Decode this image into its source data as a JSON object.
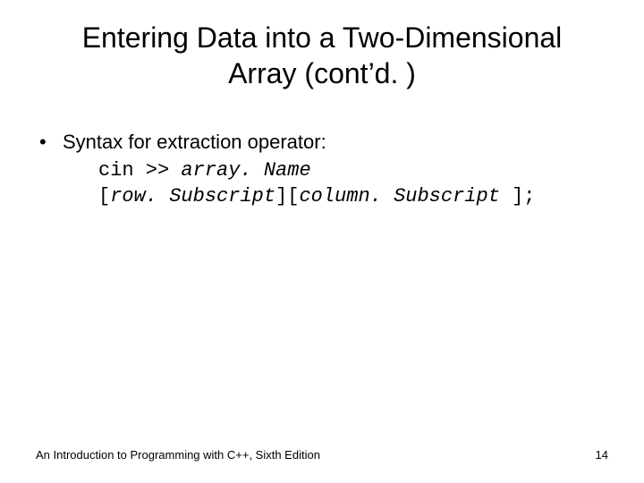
{
  "title_line1": "Entering Data into a Two-Dimensional",
  "title_line2": "Array (cont’d. )",
  "bullet": {
    "marker": "•",
    "text": "Syntax for extraction operator:"
  },
  "code": {
    "cin": "cin >> ",
    "arrayName": "array. Name",
    "open1": "[",
    "rowSub": "row. Subscript",
    "mid": "][",
    "colSub": "column. Subscript ",
    "close": "];"
  },
  "footer": {
    "left": "An Introduction to Programming with C++, Sixth Edition",
    "right": "14"
  }
}
